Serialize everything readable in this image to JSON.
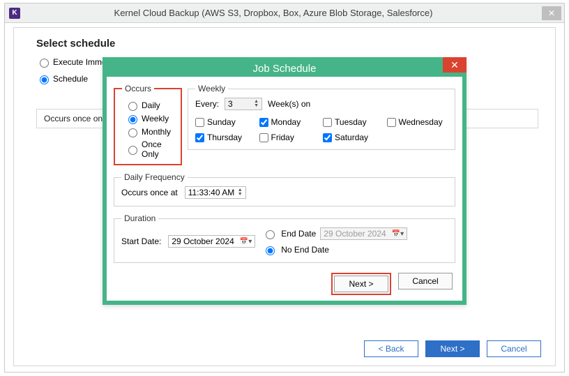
{
  "parent": {
    "icon_letter": "K",
    "title": "Kernel Cloud Backup (AWS S3, Dropbox, Box, Azure Blob Storage, Salesforce)",
    "close_glyph": "✕",
    "heading": "Select schedule",
    "opt_immediate": "Execute Immediate",
    "opt_schedule": "Schedule",
    "schedule_preview": "Occurs once on Tu",
    "btn_back": "< Back",
    "btn_next": "Next >",
    "btn_cancel": "Cancel"
  },
  "dialog": {
    "title": "Job Schedule",
    "close_glyph": "✕",
    "occurs_legend": "Occurs",
    "occurs_daily": "Daily",
    "occurs_weekly": "Weekly",
    "occurs_monthly": "Monthly",
    "occurs_once": "Once Only",
    "weekly_legend": "Weekly",
    "every_label": "Every:",
    "every_value": "3",
    "weeks_on_label": "Week(s) on",
    "day_sun": "Sunday",
    "day_mon": "Monday",
    "day_tue": "Tuesday",
    "day_wed": "Wednesday",
    "day_thu": "Thursday",
    "day_fri": "Friday",
    "day_sat": "Saturday",
    "daily_freq_legend": "Daily Frequency",
    "occurs_once_at": "Occurs once at",
    "time_value": "11:33:40 AM",
    "duration_legend": "Duration",
    "start_date_label": "Start Date:",
    "start_date_value": "29   October   2024",
    "end_date_label": "End Date",
    "end_date_value": "29   October   2024",
    "no_end_date_label": "No End Date",
    "btn_next": "Next >",
    "btn_cancel": "Cancel",
    "spinner_up": "▲",
    "spinner_down": "▼",
    "calendar_glyph": "📅▾"
  }
}
